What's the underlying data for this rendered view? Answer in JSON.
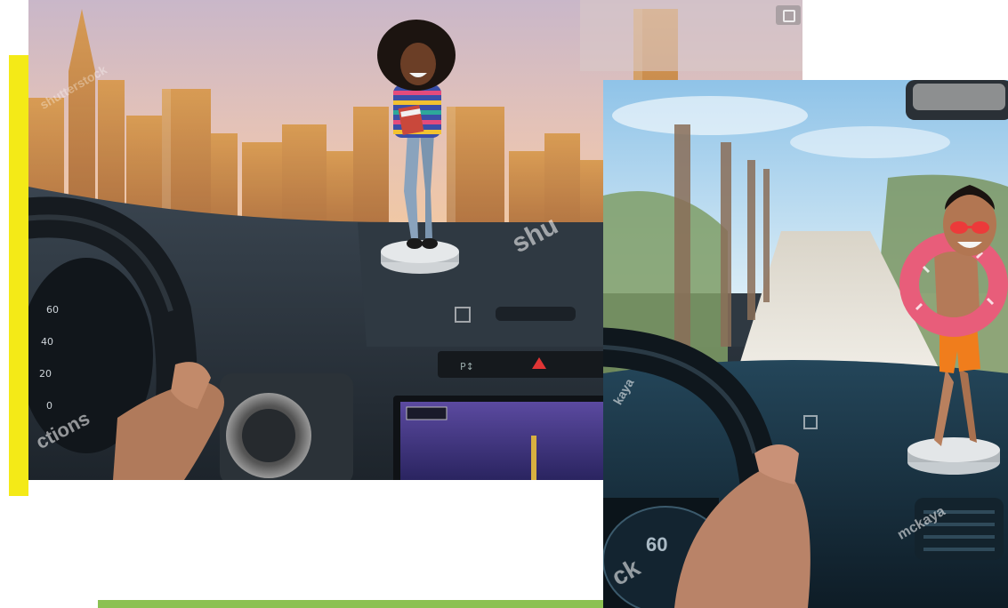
{
  "photos": {
    "left": {
      "watermarks": [
        "shu",
        "shutterstock",
        "ctions"
      ]
    },
    "right": {
      "watermarks": [
        "ck",
        "mckaya",
        "kaya"
      ],
      "speedometer": "60"
    }
  },
  "colors": {
    "accent_yellow": "#f4ea17",
    "accent_green": "#8cc152"
  }
}
